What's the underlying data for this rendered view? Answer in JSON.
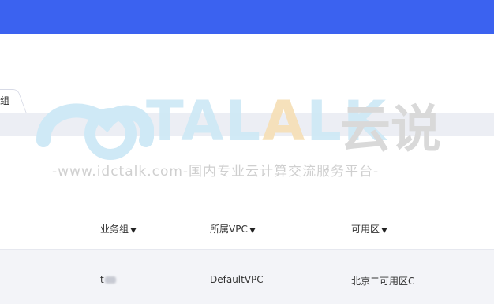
{
  "tab": {
    "label": "组"
  },
  "watermark": {
    "brand_part1": "TAL",
    "brand_a": "A",
    "brand_part2": "LK",
    "brand_cn": "云说",
    "url_line": "-www.idctalk.com-国内专业云计算交流服务平台-"
  },
  "table": {
    "headers": [
      "业务组",
      "所属VPC",
      "可用区"
    ],
    "row": {
      "group": "t",
      "vpc": "DefaultVPC",
      "zone": "北京二可用区C"
    }
  },
  "colors": {
    "topbar": "#3b62f0"
  }
}
